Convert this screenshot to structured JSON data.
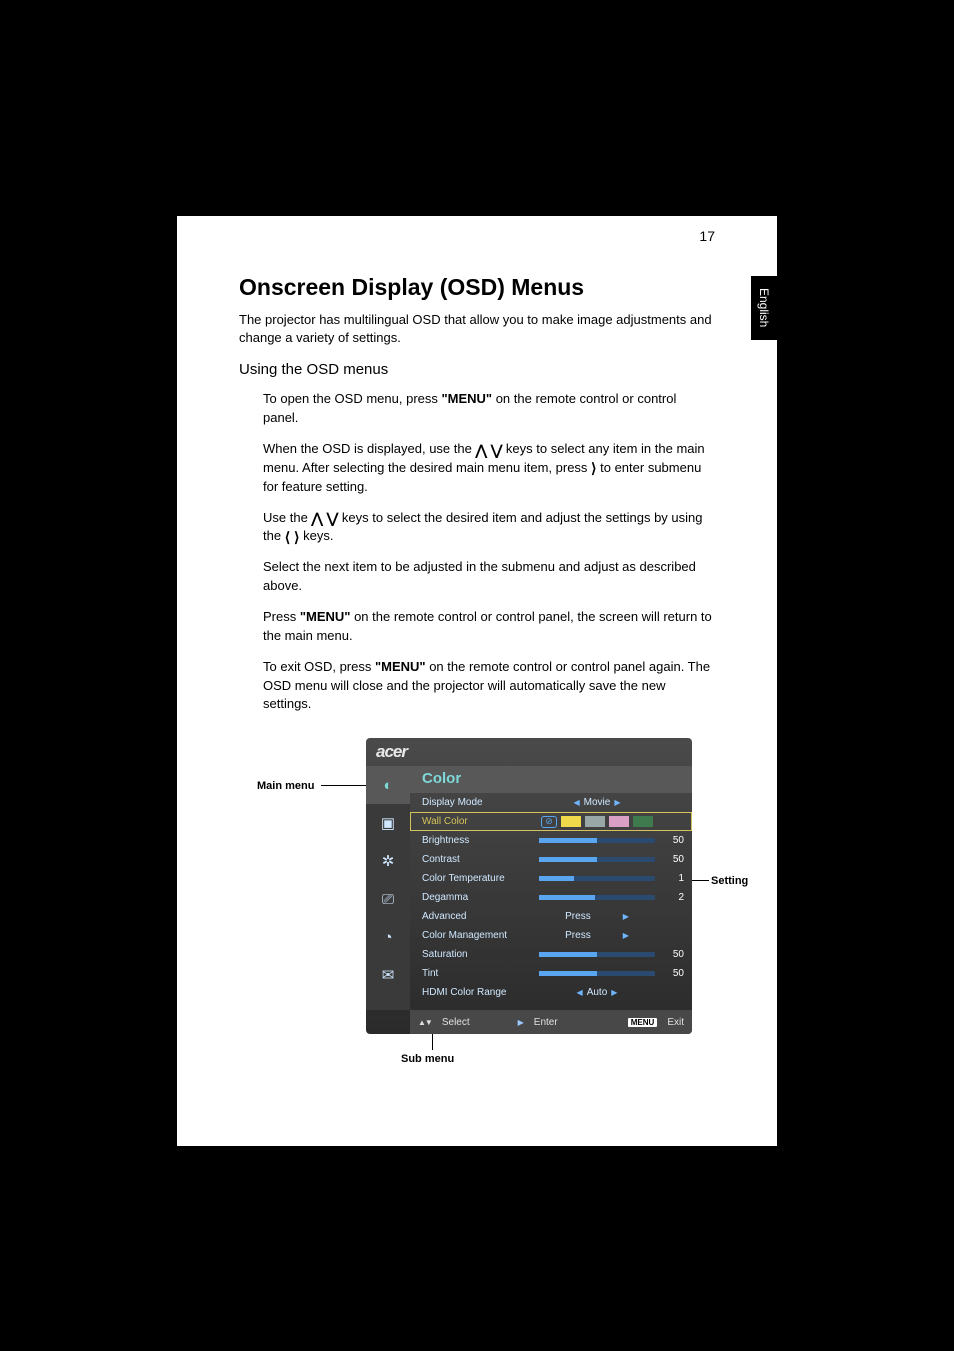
{
  "page_number": "17",
  "language_tab": "English",
  "heading": "Onscreen Display (OSD) Menus",
  "intro": "The projector has multilingual OSD that allow you to make image adjustments and change a variety of settings.",
  "subheading": "Using the OSD menus",
  "paragraphs": {
    "p1a": "To open the OSD menu, press ",
    "p1b": "\"MENU\"",
    "p1c": " on the remote control or control panel.",
    "p2a": "When the OSD is displayed, use the ",
    "p2b": " keys to select any item in the main menu. After selecting the desired main menu item, press ",
    "p2c": " to enter submenu for feature setting.",
    "p3a": "Use the ",
    "p3b": " keys to select the desired item and adjust the settings by using the ",
    "p3c": " keys.",
    "p4": "Select the next item to be adjusted in the submenu and adjust as described above.",
    "p5a": "Press ",
    "p5b": "\"MENU\"",
    "p5c": " on the remote control or control panel, the screen will return to the main menu.",
    "p6a": "To exit OSD, press ",
    "p6b": "\"MENU\"",
    "p6c": " on the remote control or control panel again. The OSD menu will close and the projector will automatically save the new settings."
  },
  "labels": {
    "main_menu": "Main menu",
    "sub_menu": "Sub menu",
    "setting": "Setting"
  },
  "osd": {
    "logo": "acer",
    "title": "Color",
    "rows": [
      {
        "label": "Display Mode",
        "type": "select",
        "value": "Movie"
      },
      {
        "label": "Wall Color",
        "type": "wallcolor",
        "selected": true
      },
      {
        "label": "Brightness",
        "type": "slider",
        "value": "50",
        "fill": 50
      },
      {
        "label": "Contrast",
        "type": "slider",
        "value": "50",
        "fill": 50
      },
      {
        "label": "Color Temperature",
        "type": "slider",
        "value": "1",
        "fill": 30
      },
      {
        "label": "Degamma",
        "type": "slider",
        "value": "2",
        "fill": 48
      },
      {
        "label": "Advanced",
        "type": "press",
        "value": "Press"
      },
      {
        "label": "Color Management",
        "type": "press",
        "value": "Press"
      },
      {
        "label": "Saturation",
        "type": "slider",
        "value": "50",
        "fill": 50
      },
      {
        "label": "Tint",
        "type": "slider",
        "value": "50",
        "fill": 50
      },
      {
        "label": "HDMI Color Range",
        "type": "select",
        "value": "Auto"
      }
    ],
    "wallcolor_swatches": [
      "#f0d94a",
      "#9aa7a7",
      "#d99fc4",
      "#3e7a4e"
    ],
    "footer": {
      "select": "Select",
      "enter": "Enter",
      "menu": "MENU",
      "exit": "Exit"
    }
  }
}
